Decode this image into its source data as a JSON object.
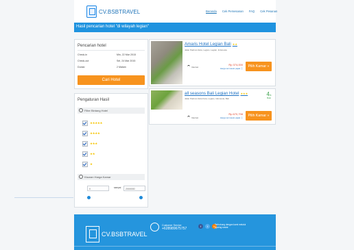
{
  "header": {
    "logo_text": "CV.BSBTRAVEL",
    "nav": [
      "Beranda",
      "Cek Pemesanan",
      "FAQ",
      "Cek Pesanan"
    ],
    "search_title": "Hasil pencarian hotel \"di wilayah legian\""
  },
  "search_panel": {
    "title": "Pencarian hotel",
    "rows": [
      {
        "label": "Check-in",
        "value": "Min, 22 Mar 2015"
      },
      {
        "label": "Check-out",
        "value": "Sel, 24 Mar 2015"
      },
      {
        "label": "Durasi",
        "value": "2 Malam"
      }
    ],
    "button": "Cari Hotel"
  },
  "filter_panel": {
    "title": "Pengaturan Hasil",
    "stars_heading": "Filter Bintang Hotel",
    "star_options": [
      "★★★★★",
      "★★★★",
      "★★★",
      "★★",
      "★"
    ],
    "price_heading": "Kisaran Harga Kamar",
    "price_min": "0",
    "price_to": "sampai",
    "price_max": "2000000"
  },
  "hotels": [
    {
      "name": "Amaris Hotel Legian Bali",
      "stars": "★★",
      "address": "Jalan Padma Utara, Legian, Legian, Indonesia",
      "wifi": "Internet",
      "price": "Rp 374,000",
      "included": "Harga termasuk pajak ⓘ",
      "button": "Pilih Kamar »"
    },
    {
      "name": "all seasons Bali Legian Hotel",
      "stars": "★★★",
      "address": "Jalan Padma Utara Kuta, Legian, Indonesia, Bali",
      "wifi": "Internet",
      "price": "Rp 670,798",
      "included": "Harga termasuk pajak ⓘ",
      "button": "Pilih Kamar »",
      "rating": "4",
      "rating_unit": "/5",
      "rating_label": "Baik"
    }
  ],
  "footer": {
    "logo_text": "CV.BSBTRAVEL",
    "cs_label": "Customer Service",
    "cs_phone": "+628989675757",
    "social_text": "Terhubung dengan kami melalui jejaring sosial",
    "social_icons": [
      "facebook-icon",
      "twitter-icon",
      "blogger-icon"
    ]
  }
}
